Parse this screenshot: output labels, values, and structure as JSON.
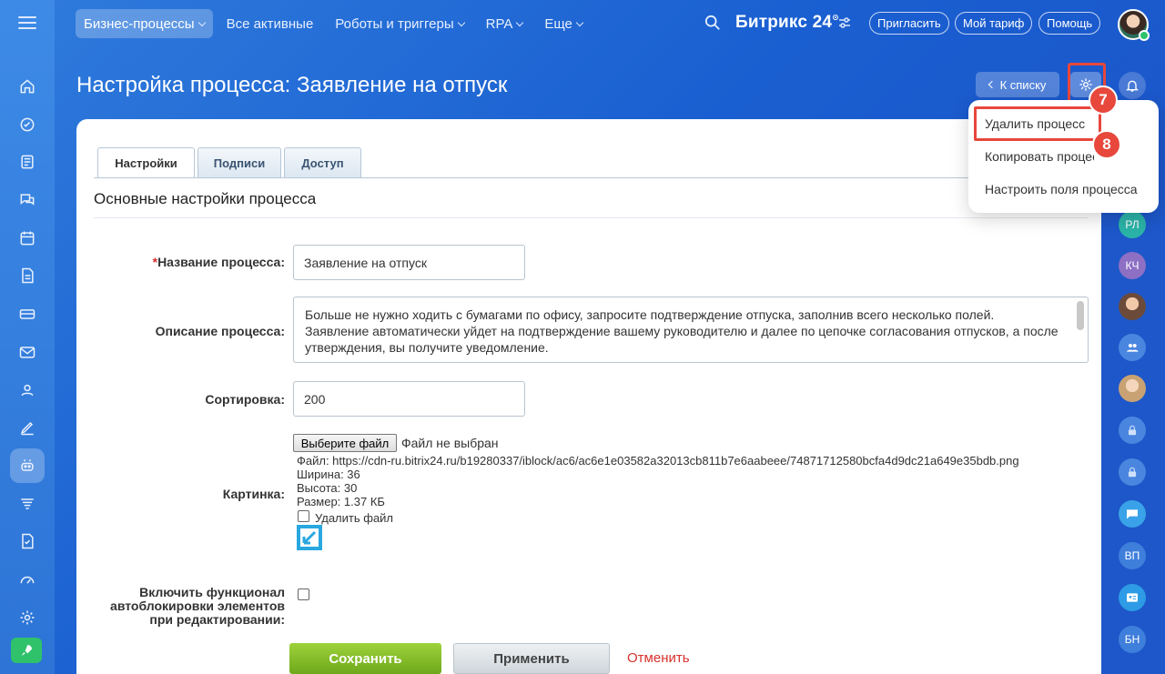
{
  "topnav": {
    "items": [
      {
        "label": "Бизнес-процессы",
        "active": true,
        "chevron": true
      },
      {
        "label": "Все активные",
        "active": false,
        "chevron": false
      },
      {
        "label": "Роботы и триггеры",
        "active": false,
        "chevron": true
      },
      {
        "label": "RPA",
        "active": false,
        "chevron": true
      },
      {
        "label": "Еще",
        "active": false,
        "chevron": true
      }
    ],
    "logo": "Битрикс 24",
    "logo_sup": "⊙",
    "invite": "Пригласить",
    "tariff": "Мой тариф",
    "help": "Помощь"
  },
  "page": {
    "title": "Настройка процесса: Заявление на отпуск",
    "back_label": "К списку"
  },
  "tabs": [
    "Настройки",
    "Подписи",
    "Доступ"
  ],
  "section_title": "Основные настройки процесса",
  "form": {
    "name_label": "Название процесса:",
    "name_required": "*",
    "name_value": "Заявление на отпуск",
    "desc_label": "Описание процесса:",
    "desc_value": "Больше не нужно ходить с бумагами по офису, запросите подтверждение отпуска, заполнив всего несколько полей. Заявление автоматически уйдет на подтверждение вашему руководителю и далее по цепочке согласования отпусков, а после утверждения, вы получите уведомление.",
    "sort_label": "Сортировка:",
    "sort_value": "200",
    "picture_label": "Картинка:",
    "file_button": "Выберите файл",
    "file_none": "Файл не выбран",
    "file_path": "Файл: https://cdn-ru.bitrix24.ru/b19280337/iblock/ac6/ac6e1e03582a32013cb811b7e6aabeee/74871712580bcfa4d9dc21a649e35bdb.png",
    "width": "Ширина: 36",
    "height": "Высота: 30",
    "size": "Размер: 1.37 КБ",
    "delete_file": "Удалить файл",
    "autolock_label_1": "Включить функционал",
    "autolock_label_2": "автоблокировки элементов",
    "autolock_label_3": "при редактировании:"
  },
  "buttons": {
    "save": "Сохранить",
    "apply": "Применить",
    "cancel": "Отменить"
  },
  "dropdown": {
    "items": [
      "Удалить процесс",
      "Копировать процесс",
      "Настроить поля процесса"
    ]
  },
  "badges": {
    "gear": "7",
    "delete": "8"
  },
  "rail": [
    "РЛ",
    "КЧ",
    "ВП",
    "БН"
  ],
  "colors": {
    "accent": "#1f63d3",
    "highlight": "#e8473c",
    "save": "#7fb927",
    "cancel": "#d8312c"
  },
  "icons": {
    "sidebar": [
      "home-icon",
      "pulse-icon",
      "feed-icon",
      "chat-icon",
      "calendar-icon",
      "document-icon",
      "card-icon",
      "mail-icon",
      "contacts-icon",
      "sign-icon",
      "robot-icon",
      "filter-icon",
      "task-icon",
      "gauge-icon",
      "settings-icon"
    ]
  }
}
